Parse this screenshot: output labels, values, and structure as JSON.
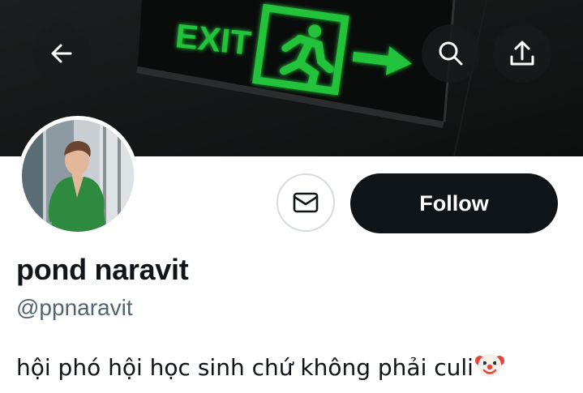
{
  "header": {
    "back_icon": "arrow-left-icon",
    "search_icon": "search-icon",
    "share_icon": "share-upload-icon"
  },
  "banner": {
    "sign_text": "EXIT",
    "sign_color": "#22c23a"
  },
  "actions": {
    "message_icon": "envelope-icon",
    "follow_label": "Follow"
  },
  "profile": {
    "display_name": "pond naravit",
    "handle": "@ppnaravit",
    "bio": "hội phó hội học sinh chứ không phải culi",
    "bio_emoji": "clown-face-icon"
  },
  "colors": {
    "primary_text": "#0f1419",
    "secondary_text": "#536471",
    "follow_button_bg": "#0f1419"
  }
}
